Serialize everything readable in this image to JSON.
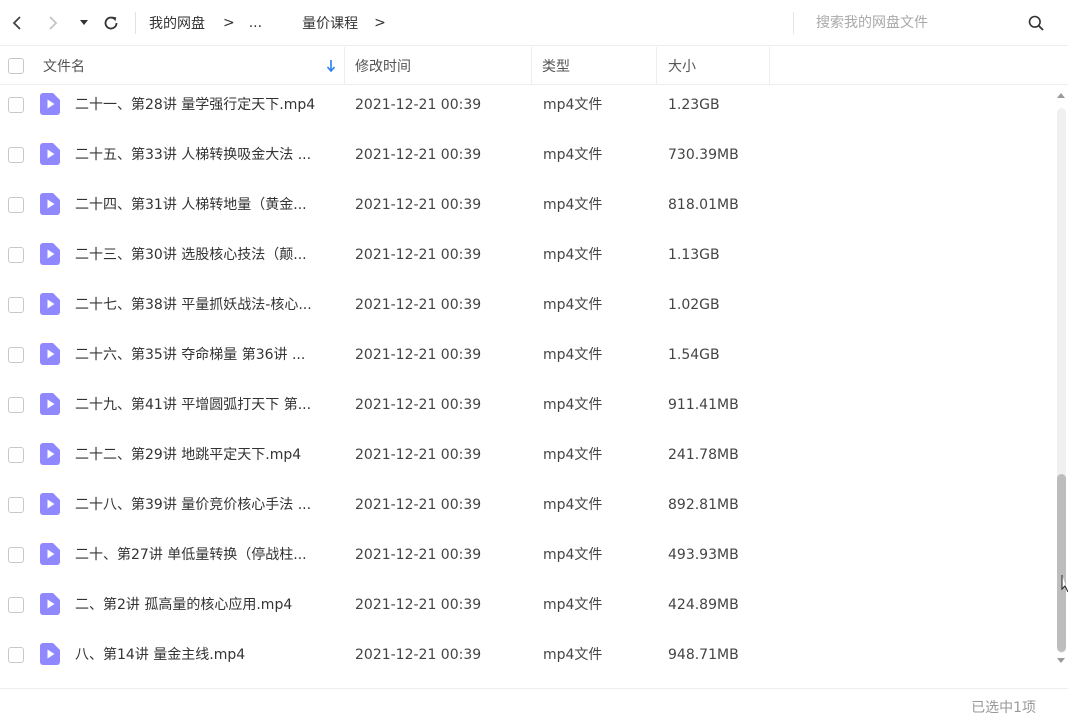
{
  "nav": {
    "back_icon": "chevron-left-icon",
    "forward_icon": "chevron-right-icon",
    "history_icon": "caret-down-icon",
    "refresh_icon": "refresh-icon"
  },
  "breadcrumb": {
    "root": "我的网盘",
    "ellipsis": "...",
    "current": "量价课程",
    "separator": ">"
  },
  "search": {
    "placeholder": "搜索我的网盘文件",
    "icon": "search-icon"
  },
  "columns": {
    "name": "文件名",
    "modified": "修改时间",
    "type": "类型",
    "size": "大小"
  },
  "files": [
    {
      "name": "二十一、第28讲 量学强行定天下.mp4",
      "modified": "2021-12-21 00:39",
      "type": "mp4文件",
      "size": "1.23GB"
    },
    {
      "name": "二十五、第33讲 人梯转换吸金大法 ...",
      "modified": "2021-12-21 00:39",
      "type": "mp4文件",
      "size": "730.39MB"
    },
    {
      "name": "二十四、第31讲 人梯转地量（黄金...",
      "modified": "2021-12-21 00:39",
      "type": "mp4文件",
      "size": "818.01MB"
    },
    {
      "name": "二十三、第30讲 选股核心技法（颠...",
      "modified": "2021-12-21 00:39",
      "type": "mp4文件",
      "size": "1.13GB"
    },
    {
      "name": "二十七、第38讲 平量抓妖战法-核心...",
      "modified": "2021-12-21 00:39",
      "type": "mp4文件",
      "size": "1.02GB"
    },
    {
      "name": "二十六、第35讲 夺命梯量  第36讲 ...",
      "modified": "2021-12-21 00:39",
      "type": "mp4文件",
      "size": "1.54GB"
    },
    {
      "name": "二十九、第41讲 平增圆弧打天下  第...",
      "modified": "2021-12-21 00:39",
      "type": "mp4文件",
      "size": "911.41MB"
    },
    {
      "name": "二十二、第29讲 地跳平定天下.mp4",
      "modified": "2021-12-21 00:39",
      "type": "mp4文件",
      "size": "241.78MB"
    },
    {
      "name": "二十八、第39讲 量价竞价核心手法 ...",
      "modified": "2021-12-21 00:39",
      "type": "mp4文件",
      "size": "892.81MB"
    },
    {
      "name": "二十、第27讲 单低量转换（停战柱...",
      "modified": "2021-12-21 00:39",
      "type": "mp4文件",
      "size": "493.93MB"
    },
    {
      "name": "二、第2讲 孤高量的核心应用.mp4",
      "modified": "2021-12-21 00:39",
      "type": "mp4文件",
      "size": "424.89MB"
    },
    {
      "name": "八、第14讲 量金主线.mp4",
      "modified": "2021-12-21 00:39",
      "type": "mp4文件",
      "size": "948.71MB"
    }
  ],
  "status": {
    "selection": "已选中1项"
  },
  "colors": {
    "file_icon": "#8f88ff",
    "sort_arrow": "#2a7ff0",
    "scroll_thumb": "#bdbdbd"
  }
}
